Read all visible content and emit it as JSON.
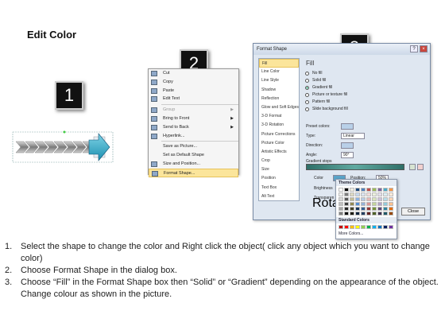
{
  "page": {
    "title": "Edit Color",
    "steps": [
      "1",
      "2",
      "3"
    ]
  },
  "context_menu": {
    "items": [
      {
        "label": "Cut",
        "icon": "scissors-icon"
      },
      {
        "label": "Copy",
        "icon": "copy-icon"
      },
      {
        "label": "Paste",
        "icon": "paste-icon"
      },
      {
        "label": "Edit Text",
        "icon": "edit-text-icon"
      },
      {
        "label": "Group",
        "icon": "group-icon",
        "submenu": true,
        "disabled": true
      },
      {
        "label": "Bring to Front",
        "icon": "bring-front-icon",
        "submenu": true
      },
      {
        "label": "Send to Back",
        "icon": "send-back-icon",
        "submenu": true
      },
      {
        "label": "Hyperlink...",
        "icon": "hyperlink-icon"
      },
      {
        "label": "Save as Picture...",
        "icon": ""
      },
      {
        "label": "Set as Default Shape",
        "icon": ""
      },
      {
        "label": "Size and Position...",
        "icon": "size-icon"
      },
      {
        "label": "Format Shape...",
        "icon": "format-shape-icon",
        "selected": true
      }
    ]
  },
  "dialog": {
    "title": "Format Shape",
    "close_label": "Close",
    "nav": [
      "Fill",
      "Line Color",
      "Line Style",
      "Shadow",
      "Reflection",
      "Glow and Soft Edges",
      "3-D Format",
      "3-D Rotation",
      "Picture Corrections",
      "Picture Color",
      "Artistic Effects",
      "Crop",
      "Size",
      "Position",
      "Text Box",
      "Alt Text"
    ],
    "pane_heading": "Fill",
    "fill_options": [
      {
        "label": "No fill",
        "selected": false
      },
      {
        "label": "Solid fill",
        "selected": false
      },
      {
        "label": "Gradient fill",
        "selected": true
      },
      {
        "label": "Picture or texture fill",
        "selected": false
      },
      {
        "label": "Pattern fill",
        "selected": false
      },
      {
        "label": "Slide background fill",
        "selected": false
      }
    ],
    "preset_colors_label": "Preset colors:",
    "type_label": "Type:",
    "type_value": "Linear",
    "direction_label": "Direction:",
    "angle_label": "Angle:",
    "angle_value": "90°",
    "gradient_stops_label": "Gradient stops",
    "color_label": "Color",
    "position_label": "Position:",
    "position_value": "50%",
    "brightness_label": "Brightness",
    "transparency_label": "Transparen",
    "rotate_label": "Rotate"
  },
  "color_popup": {
    "theme_header": "Theme Colors",
    "standard_header": "Standard Colors",
    "more_colors": "More Colors...",
    "theme_top": [
      "#ffffff",
      "#000000",
      "#eeece1",
      "#1f497d",
      "#4f81bd",
      "#c0504d",
      "#9bbb59",
      "#8064a2",
      "#4bacc6",
      "#f79646"
    ],
    "theme_shades": [
      [
        "#f2f2f2",
        "#7f7f7f",
        "#ddd9c3",
        "#c6d9f0",
        "#dbe5f1",
        "#f2dcdb",
        "#ebf1dd",
        "#e5e0ec",
        "#dbeef3",
        "#fdeada"
      ],
      [
        "#d8d8d8",
        "#595959",
        "#c4bd97",
        "#8db3e2",
        "#b8cce4",
        "#e5b9b7",
        "#d7e3bc",
        "#ccc1d9",
        "#b7dde8",
        "#fbd5b5"
      ],
      [
        "#bfbfbf",
        "#3f3f3f",
        "#938953",
        "#548dd4",
        "#95b3d7",
        "#d99694",
        "#c3d69b",
        "#b2a2c7",
        "#92cddc",
        "#fac08f"
      ],
      [
        "#a5a5a5",
        "#262626",
        "#494429",
        "#17365d",
        "#366092",
        "#953734",
        "#76923c",
        "#5f497a",
        "#31859b",
        "#e36c09"
      ],
      [
        "#7f7f7f",
        "#0c0c0c",
        "#1d1b10",
        "#0f243e",
        "#244061",
        "#632423",
        "#4f6128",
        "#3f3151",
        "#205867",
        "#974806"
      ]
    ],
    "standard": [
      "#c00000",
      "#ff0000",
      "#ffc000",
      "#ffff00",
      "#92d050",
      "#00b050",
      "#00b0f0",
      "#0070c0",
      "#002060",
      "#7030a0"
    ]
  },
  "instructions": [
    {
      "num": "1.",
      "text": "Select the shape to change the color and Right click the object( click any object which you want to change color)"
    },
    {
      "num": "2.",
      "text": "Choose Format Shape in the dialog box."
    },
    {
      "num": "3.",
      "text": "Choose “Fill” in the Format Shape box then “Solid” or “Gradient” depending on the appearance of the object. Change colour as shown in the picture."
    }
  ]
}
